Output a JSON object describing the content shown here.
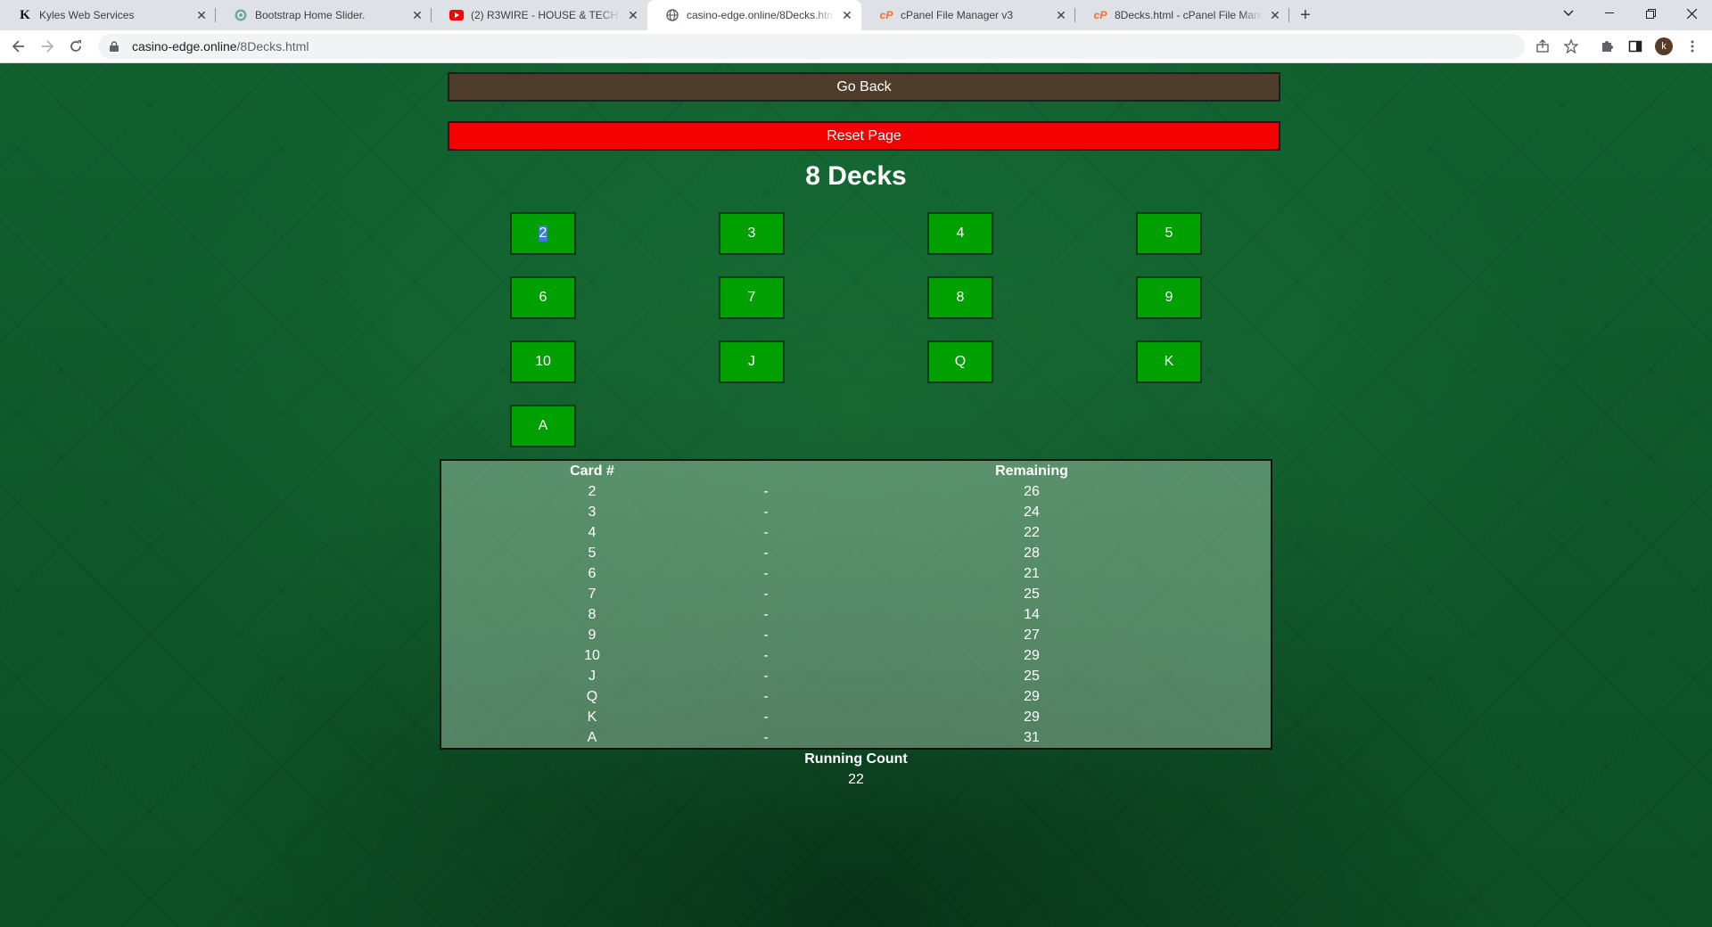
{
  "browser": {
    "tabs": [
      {
        "title": "Kyles Web Services",
        "icon": "k-logo-icon",
        "active": false
      },
      {
        "title": "Bootstrap Home Slider.",
        "icon": "chatgpt-icon",
        "active": false
      },
      {
        "title": "(2) R3WIRE - HOUSE & TECH LIVE",
        "icon": "youtube-icon",
        "active": false
      },
      {
        "title": "casino-edge.online/8Decks.html",
        "icon": "globe-icon",
        "active": true
      },
      {
        "title": "cPanel File Manager v3",
        "icon": "cpanel-icon",
        "active": false
      },
      {
        "title": "8Decks.html - cPanel File Manager",
        "icon": "cpanel-icon",
        "active": false
      }
    ],
    "url_domain": "casino-edge.online",
    "url_path": "/8Decks.html",
    "avatar_letter": "k"
  },
  "page": {
    "go_back_label": "Go Back",
    "reset_label": "Reset Page",
    "title": "8 Decks",
    "card_buttons": [
      "2",
      "3",
      "4",
      "5",
      "6",
      "7",
      "8",
      "9",
      "10",
      "J",
      "Q",
      "K",
      "A"
    ],
    "table": {
      "header": {
        "card": "Card #",
        "sep": "",
        "remaining": "Remaining"
      },
      "rows": [
        {
          "card": "2",
          "sep": "-",
          "remaining": "26"
        },
        {
          "card": "3",
          "sep": "-",
          "remaining": "24"
        },
        {
          "card": "4",
          "sep": "-",
          "remaining": "22"
        },
        {
          "card": "5",
          "sep": "-",
          "remaining": "28"
        },
        {
          "card": "6",
          "sep": "-",
          "remaining": "21"
        },
        {
          "card": "7",
          "sep": "-",
          "remaining": "25"
        },
        {
          "card": "8",
          "sep": "-",
          "remaining": "14"
        },
        {
          "card": "9",
          "sep": "-",
          "remaining": "27"
        },
        {
          "card": "10",
          "sep": "-",
          "remaining": "29"
        },
        {
          "card": "J",
          "sep": "-",
          "remaining": "25"
        },
        {
          "card": "Q",
          "sep": "-",
          "remaining": "29"
        },
        {
          "card": "K",
          "sep": "-",
          "remaining": "29"
        },
        {
          "card": "A",
          "sep": "-",
          "remaining": "31"
        }
      ]
    },
    "running_count_label": "Running Count",
    "running_count_value": "22"
  },
  "colors": {
    "go_back_bg": "#4f3d2c",
    "reset_bg": "#f40000",
    "card_button_bg": "#00a000",
    "felt_green": "#11612f"
  }
}
